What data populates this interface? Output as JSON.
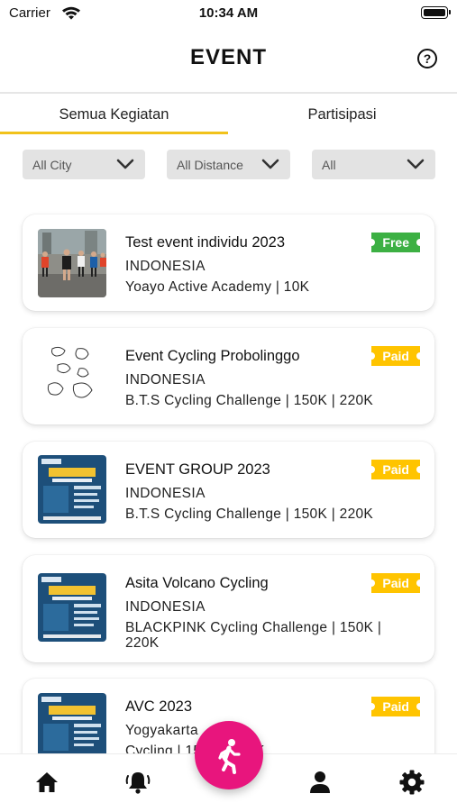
{
  "status_bar": {
    "carrier": "Carrier",
    "time": "10:34 AM"
  },
  "header": {
    "title": "EVENT"
  },
  "tabs": [
    {
      "label": "Semua Kegiatan",
      "active": true
    },
    {
      "label": "Partisipasi",
      "active": false
    }
  ],
  "filters": [
    {
      "value": "All City"
    },
    {
      "value": "All Distance"
    },
    {
      "value": "All"
    }
  ],
  "events": [
    {
      "title": "Test event individu 2023",
      "location": "INDONESIA",
      "details": "Yoayo Active Academy  | 10K",
      "badge": "Free",
      "thumbnail": "running-race-photo"
    },
    {
      "title": "Event Cycling Probolinggo",
      "location": "INDONESIA",
      "details": "B.T.S Cycling Challenge  | 150K | 220K",
      "badge": "Paid",
      "thumbnail": "mango-sketch"
    },
    {
      "title": "EVENT GROUP 2023",
      "location": "INDONESIA",
      "details": "B.T.S Cycling Challenge  | 150K | 220K",
      "badge": "Paid",
      "thumbnail": "cycling-poster"
    },
    {
      "title": "Asita Volcano Cycling",
      "location": "INDONESIA",
      "details": "BLACKPINK Cycling Challenge  | 150K | 220K",
      "badge": "Paid",
      "thumbnail": "cycling-poster"
    },
    {
      "title": "AVC 2023",
      "location": "Yogyakarta",
      "details": "Cycling  | 150K | 220K",
      "badge": "Paid",
      "thumbnail": "cycling-poster"
    }
  ],
  "bottom_nav": [
    {
      "icon": "home-icon"
    },
    {
      "icon": "bell-icon"
    },
    {
      "icon": "running-person-icon"
    },
    {
      "icon": "user-icon"
    },
    {
      "icon": "gear-icon"
    }
  ],
  "colors": {
    "accent": "#f1c21b",
    "free": "#3cb043",
    "paid": "#ffc400",
    "fab": "#e8157d"
  }
}
